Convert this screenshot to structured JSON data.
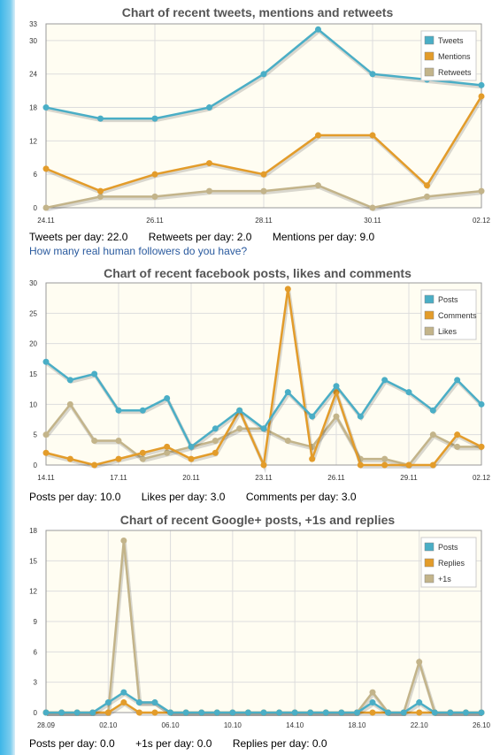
{
  "charts": [
    {
      "title": "Chart of recent tweets, mentions and retweets",
      "stats": [
        "Tweets per day: 22.0",
        "Retweets per day: 2.0",
        "Mentions per day: 9.0"
      ],
      "link": "How many real human followers do you have?",
      "chart_data": {
        "type": "line",
        "title": "Chart of recent tweets, mentions and retweets",
        "x_tick_labels": [
          "24.11",
          "26.11",
          "28.11",
          "30.11",
          "02.12"
        ],
        "x_tick_positions": [
          0,
          2,
          4,
          6,
          8
        ],
        "x_range": [
          0,
          8
        ],
        "y_ticks": [
          0,
          6,
          12,
          18,
          24,
          30,
          33
        ],
        "ylim": [
          0,
          33
        ],
        "grid": true,
        "legend_position": "top-right",
        "series": [
          {
            "name": "Tweets",
            "color": "#4aaec6",
            "x": [
              0,
              1,
              2,
              3,
              4,
              5,
              6,
              7,
              8
            ],
            "values": [
              18,
              16,
              16,
              18,
              24,
              32,
              24,
              23,
              22
            ]
          },
          {
            "name": "Mentions",
            "color": "#e39c2a",
            "x": [
              0,
              1,
              2,
              3,
              4,
              5,
              6,
              7,
              8
            ],
            "values": [
              7,
              3,
              6,
              8,
              6,
              13,
              13,
              4,
              20
            ]
          },
          {
            "name": "Retweets",
            "color": "#c3b48a",
            "x": [
              0,
              1,
              2,
              3,
              4,
              5,
              6,
              7,
              8
            ],
            "values": [
              0,
              2,
              2,
              3,
              3,
              4,
              0,
              2,
              3
            ]
          }
        ]
      }
    },
    {
      "title": "Chart of recent facebook posts, likes and comments",
      "stats": [
        "Posts per day: 10.0",
        "Likes per day: 3.0",
        "Comments per day: 3.0"
      ],
      "chart_data": {
        "type": "line",
        "title": "Chart of recent facebook posts, likes and comments",
        "x_tick_labels": [
          "14.11",
          "17.11",
          "20.11",
          "23.11",
          "26.11",
          "29.11",
          "02.12"
        ],
        "x_tick_positions": [
          0,
          3,
          6,
          9,
          12,
          15,
          18
        ],
        "x_range": [
          0,
          18
        ],
        "y_ticks": [
          0,
          5,
          10,
          15,
          20,
          25,
          30
        ],
        "ylim": [
          0,
          30
        ],
        "grid": true,
        "legend_position": "top-right",
        "series": [
          {
            "name": "Posts",
            "color": "#4aaec6",
            "x": [
              0,
              1,
              2,
              3,
              4,
              5,
              6,
              7,
              8,
              9,
              10,
              11,
              12,
              13,
              14,
              15,
              16,
              17,
              18
            ],
            "values": [
              17,
              14,
              15,
              9,
              9,
              11,
              3,
              6,
              9,
              6,
              12,
              8,
              13,
              8,
              14,
              12,
              9,
              14,
              10
            ]
          },
          {
            "name": "Comments",
            "color": "#e39c2a",
            "x": [
              0,
              1,
              2,
              3,
              4,
              5,
              6,
              7,
              8,
              9,
              10,
              11,
              12,
              13,
              14,
              15,
              16,
              17,
              18
            ],
            "values": [
              2,
              1,
              0,
              1,
              2,
              3,
              1,
              2,
              9,
              0,
              29,
              1,
              12,
              0,
              0,
              0,
              0,
              5,
              3
            ]
          },
          {
            "name": "Likes",
            "color": "#c3b48a",
            "x": [
              0,
              1,
              2,
              3,
              4,
              5,
              6,
              7,
              8,
              9,
              10,
              11,
              12,
              13,
              14,
              15,
              16,
              17,
              18
            ],
            "values": [
              5,
              10,
              4,
              4,
              1,
              2,
              3,
              4,
              6,
              6,
              4,
              3,
              8,
              1,
              1,
              0,
              5,
              3,
              3
            ]
          }
        ]
      }
    },
    {
      "title": "Chart of recent Google+ posts, +1s and replies",
      "stats": [
        "Posts per day: 0.0",
        "+1s per day: 0.0",
        "Replies per day: 0.0"
      ],
      "chart_data": {
        "type": "line",
        "title": "Chart of recent Google+ posts, +1s and replies",
        "x_tick_labels": [
          "28.09",
          "02.10",
          "06.10",
          "10.10",
          "14.10",
          "18.10",
          "22.10",
          "26.10"
        ],
        "x_tick_positions": [
          0,
          4,
          8,
          12,
          16,
          20,
          24,
          28
        ],
        "x_range": [
          0,
          28
        ],
        "y_ticks": [
          0,
          3,
          6,
          9,
          12,
          15,
          18
        ],
        "ylim": [
          0,
          18
        ],
        "grid": true,
        "legend_position": "top-right",
        "series": [
          {
            "name": "Posts",
            "color": "#4aaec6",
            "x": [
              0,
              1,
              2,
              3,
              4,
              5,
              6,
              7,
              8,
              9,
              10,
              11,
              12,
              13,
              14,
              15,
              16,
              17,
              18,
              19,
              20,
              21,
              22,
              23,
              24,
              25,
              26,
              27,
              28
            ],
            "values": [
              0,
              0,
              0,
              0,
              1,
              2,
              1,
              1,
              0,
              0,
              0,
              0,
              0,
              0,
              0,
              0,
              0,
              0,
              0,
              0,
              0,
              1,
              0,
              0,
              1,
              0,
              0,
              0,
              0
            ]
          },
          {
            "name": "Replies",
            "color": "#e39c2a",
            "x": [
              0,
              1,
              2,
              3,
              4,
              5,
              6,
              7,
              8,
              9,
              10,
              11,
              12,
              13,
              14,
              15,
              16,
              17,
              18,
              19,
              20,
              21,
              22,
              23,
              24,
              25,
              26,
              27,
              28
            ],
            "values": [
              0,
              0,
              0,
              0,
              0,
              1,
              0,
              0,
              0,
              0,
              0,
              0,
              0,
              0,
              0,
              0,
              0,
              0,
              0,
              0,
              0,
              0,
              0,
              0,
              0,
              0,
              0,
              0,
              0
            ]
          },
          {
            "name": "+1s",
            "color": "#c3b48a",
            "x": [
              0,
              1,
              2,
              3,
              4,
              5,
              6,
              7,
              8,
              9,
              10,
              11,
              12,
              13,
              14,
              15,
              16,
              17,
              18,
              19,
              20,
              21,
              22,
              23,
              24,
              25,
              26,
              27,
              28
            ],
            "values": [
              0,
              0,
              0,
              0,
              0,
              17,
              1,
              1,
              0,
              0,
              0,
              0,
              0,
              0,
              0,
              0,
              0,
              0,
              0,
              0,
              0,
              2,
              0,
              0,
              5,
              0,
              0,
              0,
              0
            ]
          }
        ]
      }
    }
  ]
}
